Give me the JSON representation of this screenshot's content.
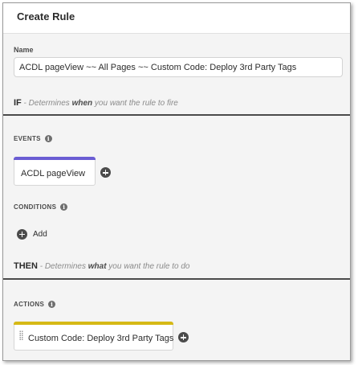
{
  "header": {
    "title": "Create Rule"
  },
  "name_field": {
    "label": "Name",
    "value": "ACDL pageView ~~ All Pages ~~ Custom Code: Deploy 3rd Party Tags"
  },
  "if_section": {
    "keyword": "IF",
    "desc_pre": " - Determines ",
    "desc_emph": "when",
    "desc_post": " you want the rule to fire"
  },
  "events": {
    "label": "EVENTS",
    "info_icon": "info-icon",
    "items": [
      {
        "label": "ACDL pageView",
        "accent": "#6b5dd3"
      }
    ]
  },
  "conditions": {
    "label": "CONDITIONS",
    "info_icon": "info-icon",
    "add_label": "Add"
  },
  "then_section": {
    "keyword": "THEN",
    "desc_pre": " - Determines ",
    "desc_emph": "what",
    "desc_post": " you want the rule to do"
  },
  "actions": {
    "label": "ACTIONS",
    "info_icon": "info-icon",
    "items": [
      {
        "label": "Custom Code: Deploy 3rd Party Tags",
        "accent": "#d6b916"
      }
    ]
  },
  "colors": {
    "event_accent": "#6b5dd3",
    "action_accent": "#d6b916",
    "divider": "#4b4b4b"
  }
}
